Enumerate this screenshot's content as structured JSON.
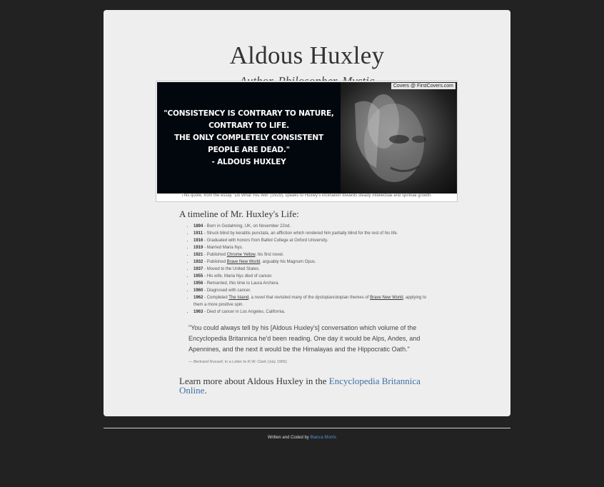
{
  "header": {
    "title": "Aldous Huxley",
    "subtitle": "Author, Philosopher, Mystic"
  },
  "figure": {
    "quote_lines": [
      "\"CONSISTENCY IS CONTRARY TO NATURE,",
      "CONTRARY TO LIFE.",
      "THE ONLY COMPLETELY CONSISTENT",
      "PEOPLE ARE DEAD.\"",
      "- ALDOUS HUXLEY"
    ],
    "credit": "Covers @ FirstCovers.com",
    "caption": "This quote, from the essay \"Do What You Will\" (1929), speaks to Huxley's inclination towards steady intellectual and spiritual growth."
  },
  "timeline": {
    "heading": "A timeline of Mr. Huxley's Life:",
    "items": [
      {
        "year": "1894",
        "pre": " - Born in Godalming, UK, on November 22nd.",
        "link": "",
        "post": ""
      },
      {
        "year": "1911",
        "pre": " - Struck blind by keratitis punctata, an affliction which rendered him partially blind for the rest of his life.",
        "link": "",
        "post": ""
      },
      {
        "year": "1916",
        "pre": " - Graduated with honors from Balliol College at Oxford University.",
        "link": "",
        "post": ""
      },
      {
        "year": "1919",
        "pre": " - Married Maria Nys.",
        "link": "",
        "post": ""
      },
      {
        "year": "1921",
        "pre": " - Published ",
        "link": "Chrome Yellow",
        "post": ", his first novel."
      },
      {
        "year": "1932",
        "pre": " - Published ",
        "link": "Brave New World",
        "post": ", arguably his Magnum Opus."
      },
      {
        "year": "1937",
        "pre": " - Moved to the United States.",
        "link": "",
        "post": ""
      },
      {
        "year": "1955",
        "pre": " - His wife, Maria Nys died of cancer.",
        "link": "",
        "post": ""
      },
      {
        "year": "1956",
        "pre": " - Remarried, this time to Laura Archera.",
        "link": "",
        "post": ""
      },
      {
        "year": "1960",
        "pre": " - Diagnosed with cancer.",
        "link": "",
        "post": ""
      },
      {
        "year": "1962",
        "pre": " - Completed ",
        "link": "The Island",
        "post": ", a novel that revisited many of the dystopian/utopian themes of ",
        "link2": "Brave New World",
        "post2": ", applying to them a more positive spin."
      },
      {
        "year": "1963",
        "pre": " - Died of cancer in Los Angeles, California.",
        "link": "",
        "post": ""
      }
    ]
  },
  "quote": {
    "text": "\"You could always tell by his [Aldous Huxley's] conversation which volume of the Encyclopedia Britannica he'd been reading. One day it would be Alps, Andes, and Apennines, and the next it would be the Himalayas and the Hippocratic Oath.\"",
    "attribution_prefix": "— ",
    "author": "Bertrand Russell",
    "source": ", in a Letter to R.W. Clark (July 1965)"
  },
  "learn_more": {
    "text": "Learn more about Aldous Huxley in the ",
    "link": "Encyclopedia Britannica Online",
    "suffix": "."
  },
  "footer": {
    "text": "Written and Coded by ",
    "author": "Bianca Morris"
  },
  "colors": {
    "page_bg": "#222222",
    "card_bg": "#eeeeee",
    "link": "#3f6ea6"
  }
}
